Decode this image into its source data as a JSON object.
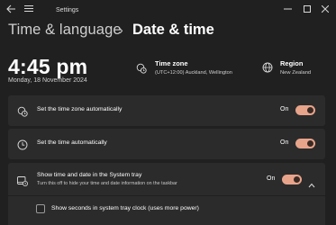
{
  "window": {
    "title": "Settings",
    "back_icon": "back-arrow-icon",
    "menu_icon": "hamburger-icon"
  },
  "breadcrumb": {
    "parent": "Time & language",
    "separator": "›",
    "current": "Date & time"
  },
  "clock": {
    "time": "4:45 pm",
    "date": "Monday, 18 November 2024"
  },
  "time_zone": {
    "label": "Time zone",
    "value": "(UTC+12:00) Auckland, Wellington"
  },
  "region": {
    "label": "Region",
    "value": "New Zealand"
  },
  "settings": [
    {
      "label": "Set the time zone automatically",
      "state": "On",
      "icon": "timezone-auto-icon"
    },
    {
      "label": "Set the time automatically",
      "state": "On",
      "icon": "clock-icon"
    },
    {
      "label": "Show time and date in the System tray",
      "sublabel": "Turn this off to hide your time and date information on the taskbar",
      "state": "On",
      "icon": "system-tray-icon"
    }
  ],
  "tray_option": {
    "label": "Show seconds in system tray clock (uses more power)",
    "checked": false
  },
  "colors": {
    "background": "#202020",
    "card": "#2b2b2b",
    "accent": "#e8a48b"
  }
}
